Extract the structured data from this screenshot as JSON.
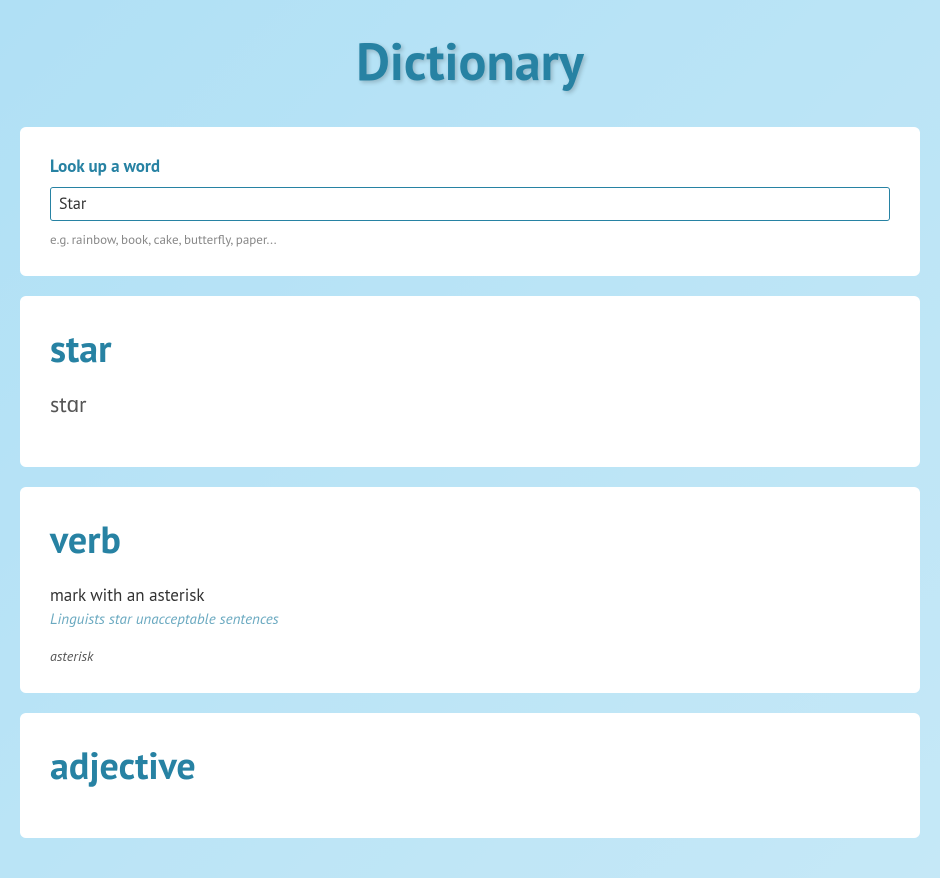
{
  "header": {
    "title": "Dictionary"
  },
  "search": {
    "label": "Look up a word",
    "value": "Star",
    "hint": "e.g. rainbow, book, cake, butterfly, paper..."
  },
  "entry": {
    "word": "star",
    "pronunciation": "stɑr"
  },
  "senses": [
    {
      "pos": "verb",
      "definition": "mark with an asterisk",
      "example": "Linguists star unacceptable sentences",
      "synonym": "asterisk"
    },
    {
      "pos": "adjective"
    }
  ]
}
